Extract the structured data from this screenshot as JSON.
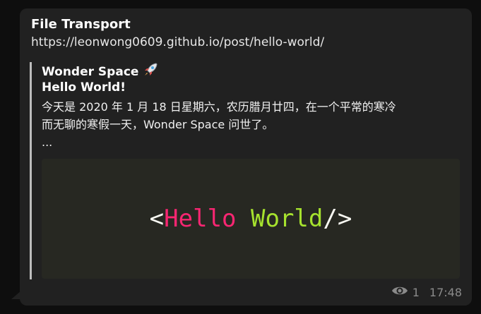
{
  "message": {
    "sender": "File Transport",
    "link": "https://leonwong0609.github.io/post/hello-world/",
    "preview": {
      "site_name": "Wonder Space",
      "title": "Hello World!",
      "description_lines": [
        "今天是 2020 年 1 月 18 日星期六，农历腊月廿四，在一个平常的寒冷",
        "而无聊的寒假一天，Wonder Space 问世了。",
        "..."
      ],
      "image": {
        "open_bracket": "<",
        "hello": "Hello",
        "space": " ",
        "world": "World",
        "close_bracket": "/>"
      }
    },
    "views": "1",
    "time": "17:48"
  },
  "colors": {
    "bubble": "#212121",
    "background": "#0e0e0e",
    "quote_bar": "#bdbdbd",
    "code_background": "#272822",
    "hello": "#f92672",
    "world": "#a6e22e",
    "meta": "#8a8a8a"
  },
  "icons": {
    "site": "rocket-icon",
    "views": "eye-icon"
  }
}
